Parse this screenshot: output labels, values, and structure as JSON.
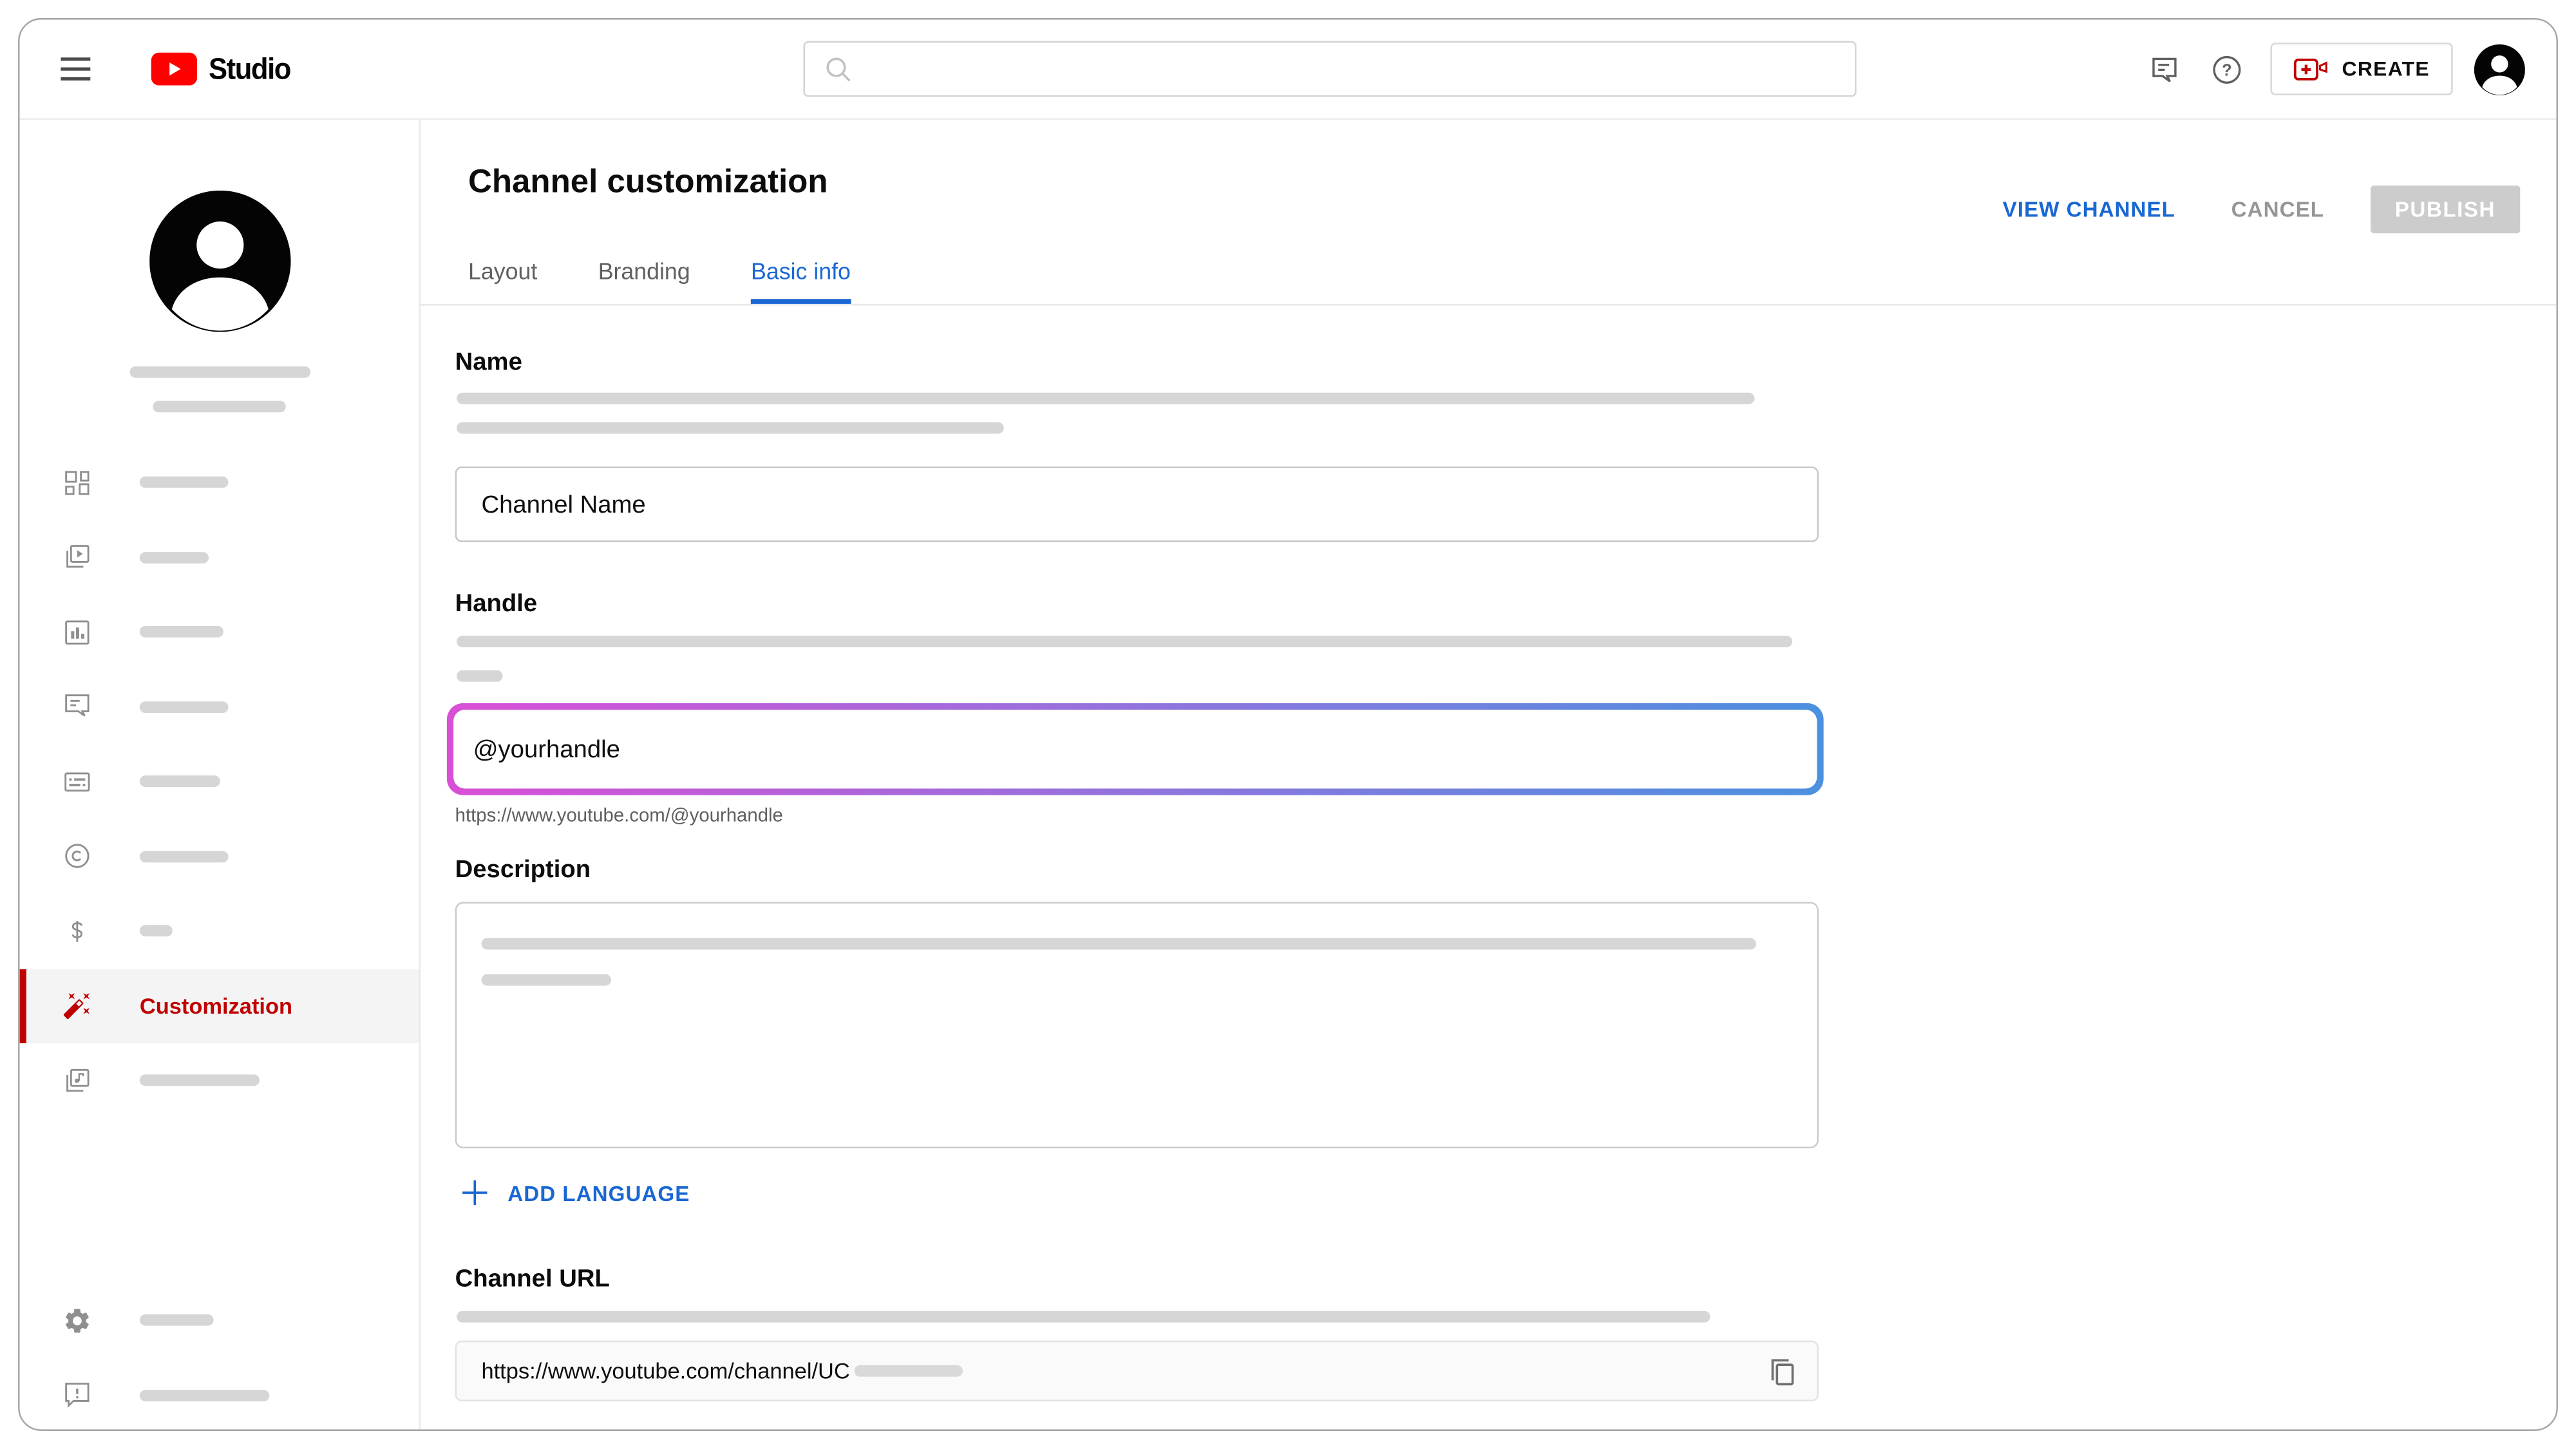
{
  "topbar": {
    "logo_text": "Studio",
    "search_placeholder": "",
    "create_label": "CREATE"
  },
  "page": {
    "title": "Channel customization",
    "actions": {
      "view_channel": "VIEW CHANNEL",
      "cancel": "CANCEL",
      "publish": "PUBLISH"
    },
    "tabs": [
      {
        "label": "Layout",
        "active": false
      },
      {
        "label": "Branding",
        "active": false
      },
      {
        "label": "Basic info",
        "active": true
      }
    ]
  },
  "sidebar": {
    "selected_item_label": "Customization"
  },
  "form": {
    "name": {
      "label": "Name",
      "value": "Channel Name"
    },
    "handle": {
      "label": "Handle",
      "value": "@yourhandle",
      "url_preview": "https://www.youtube.com/@yourhandle"
    },
    "description": {
      "label": "Description"
    },
    "add_language_label": "ADD LANGUAGE",
    "channel_url": {
      "label": "Channel URL",
      "value": "https://www.youtube.com/channel/UC"
    }
  },
  "colors": {
    "brand_red": "#ff0000",
    "accent_red": "#c00000",
    "link_blue": "#1967d2",
    "disabled_button_bg": "#cccccc",
    "placeholder_bar": "#d6d6d6",
    "handle_gradient": [
      "#d94fd6",
      "#8f75dd",
      "#4b90e0"
    ]
  },
  "icons": [
    "hamburger-menu-icon",
    "youtube-play-icon",
    "search-icon",
    "feedback-icon",
    "help-icon",
    "create-video-icon",
    "avatar-icon",
    "dashboard-icon",
    "content-icon",
    "analytics-icon",
    "comments-icon",
    "subtitles-icon",
    "copyright-icon",
    "monetization-icon",
    "customization-wand-icon",
    "audio-library-icon",
    "settings-gear-icon",
    "send-feedback-icon",
    "plus-icon",
    "copy-icon"
  ]
}
